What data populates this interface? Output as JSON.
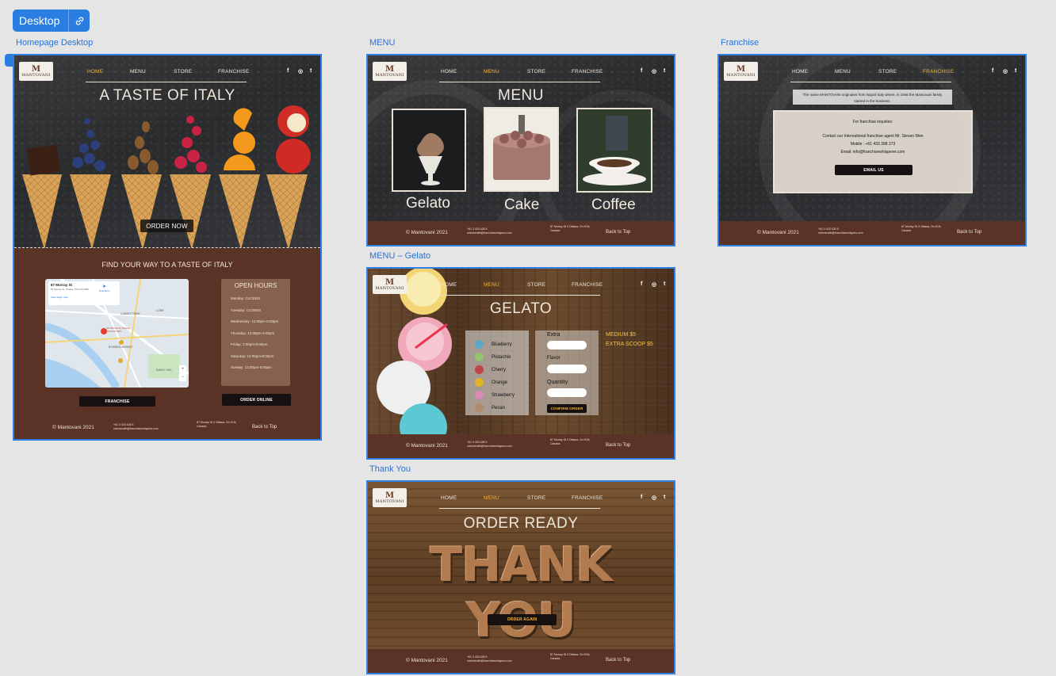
{
  "device": {
    "label": "Desktop"
  },
  "frames": {
    "home": "Homepage Desktop",
    "menu": "MENU",
    "franchise": "Franchise",
    "gelato": "MENU – Gelato",
    "thankyou": "Thank You"
  },
  "site": {
    "logo_text": "MANTOVANI",
    "logo_mark": "M",
    "nav": [
      "HOME",
      "MENU",
      "STORE",
      "FRANCHISE"
    ],
    "social": [
      "f",
      "◎",
      "t"
    ],
    "footer": {
      "copyright": "© Mantovani 2021",
      "contact": "+61 3 433 428 5 mrbohealth@franchisewhispers.com",
      "address": "87 Murray St 3 Ottawa, On K1N, Canada",
      "back_to_top": "Back to Top"
    }
  },
  "home": {
    "hero_title": "A TASTE OF ITALY",
    "order_now": "ORDER NOW",
    "find_title": "FIND YOUR WAY TO A TASTE OF ITALY",
    "map": {
      "place": "87 Murray St",
      "address": "87 Murray St, Ottawa, ON K1N 5M5",
      "directions": "Directions",
      "larger": "View larger map",
      "pin": "87 Murray St, Ottawa, ON K1N 5M5",
      "labels": [
        "LOWER TOWN",
        "BYWARD MARKET",
        "SANDY HILL",
        "LOEB"
      ]
    },
    "hours_title": "OPEN HOURS",
    "hours": [
      "Monday: CLOSED",
      "Tuesday: CLOSED",
      "Wednesday: 12:00pm-6:00pm",
      "Thursday: 12:00pm-6:00pm",
      "Friday: 1:00pm-8:00pm",
      "Saturday: 12:00pm-8:00pm",
      "Sunday: 12:00pm-6:00pm"
    ],
    "franchise_btn": "FRANCHISE",
    "order_online_btn": "ORDER ONLINE"
  },
  "menu_page": {
    "title": "MENU",
    "items": [
      "Gelato",
      "Cake",
      "Coffee"
    ]
  },
  "franchise_page": {
    "intro": "The name MANTOVANI originates from Napoli Italy where, in 1946 the Mantovani family started in the business.",
    "inquiries": "For franchise inquiries:",
    "contact_line": "Contact our International franchise agent Mr. Steven Wen",
    "mobile": "Mobile : +61 433 288 373",
    "email": "Email: info@franchisewhisperer.com",
    "email_btn": "EMAIL US"
  },
  "gelato_page": {
    "title": "GELATO",
    "flavors": [
      {
        "name": "Blueberry",
        "color": "#5aa7c9"
      },
      {
        "name": "Pistachio",
        "color": "#93c46f"
      },
      {
        "name": "Cherry",
        "color": "#c0444a"
      },
      {
        "name": "Orange",
        "color": "#e0b423"
      },
      {
        "name": "Strawberry",
        "color": "#d98bb9"
      },
      {
        "name": "Pecan",
        "color": "#b08a6a"
      }
    ],
    "fields": [
      "Extra",
      "Flavor",
      "Quantity"
    ],
    "confirm_btn": "CONFIRM ORDER",
    "prices": [
      "MEDIUM $5",
      "EXTRA SCOOP $5"
    ]
  },
  "thanks_page": {
    "title": "ORDER READY",
    "letters": "THANK YOU",
    "order_again_btn": "ORDER AGAIN"
  },
  "colors": {
    "accent": "#2a7de1",
    "footer_brown": "#5a3226",
    "nav_active": "#f1b43b"
  }
}
